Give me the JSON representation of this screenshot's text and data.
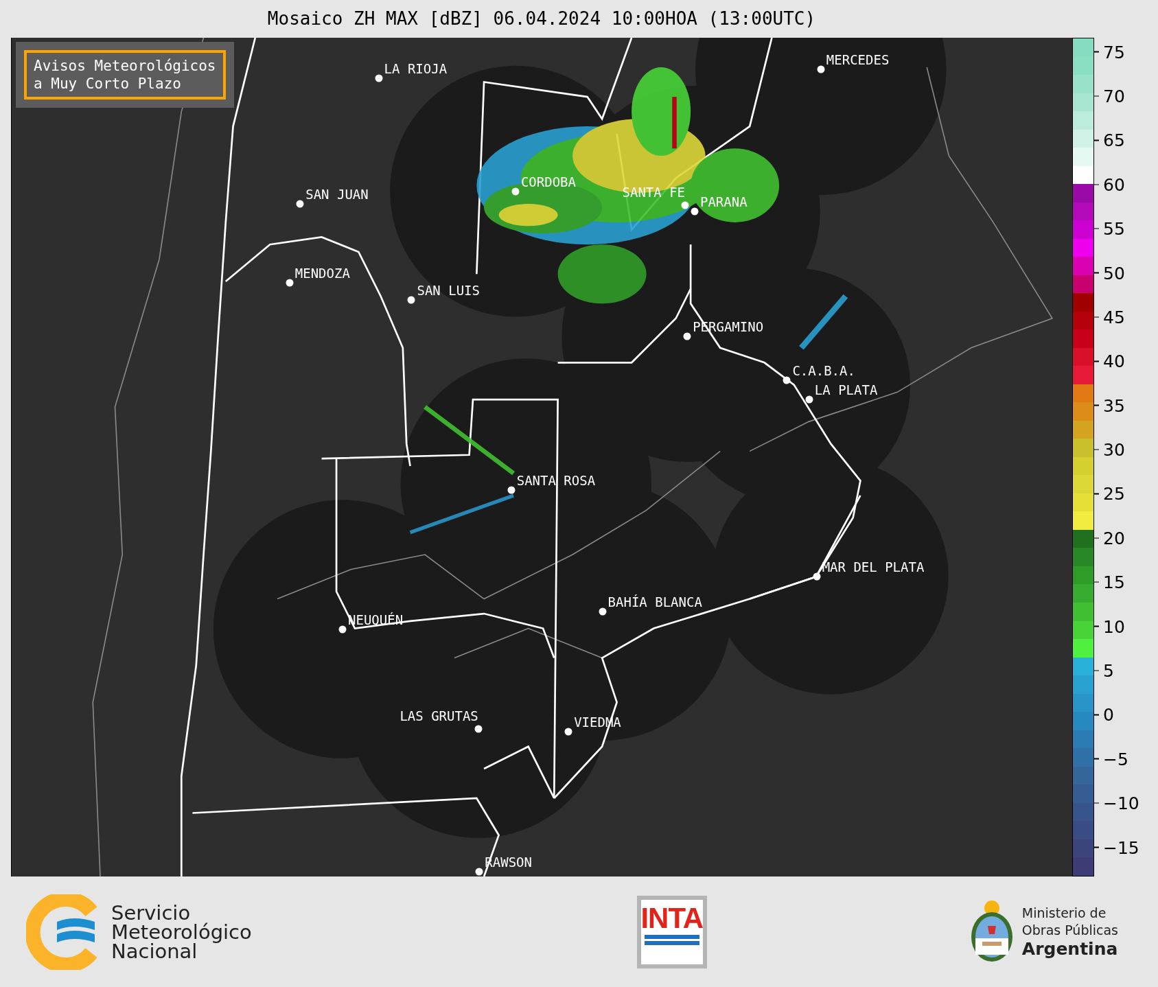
{
  "title": "Mosaico ZH MAX [dBZ] 06.04.2024 10:00HOA (13:00UTC)",
  "notice": {
    "lines": [
      "Avisos Meteorológicos",
      "a Muy Corto Plazo"
    ]
  },
  "cities": [
    {
      "name": "LA RIOJA"
    },
    {
      "name": "MERCEDES"
    },
    {
      "name": "CORDOBA"
    },
    {
      "name": "SAN JUAN"
    },
    {
      "name": "SANTA FE"
    },
    {
      "name": "PARANA"
    },
    {
      "name": "MENDOZA"
    },
    {
      "name": "SAN LUIS"
    },
    {
      "name": "PERGAMINO"
    },
    {
      "name": "C.A.B.A."
    },
    {
      "name": "LA PLATA"
    },
    {
      "name": "SANTA ROSA"
    },
    {
      "name": "MAR DEL PLATA"
    },
    {
      "name": "BAHÍA BLANCA"
    },
    {
      "name": "NEUQUÉN"
    },
    {
      "name": "LAS GRUTAS"
    },
    {
      "name": "VIEDMA"
    },
    {
      "name": "RAWSON"
    }
  ],
  "colorbar": {
    "ticks": [
      "75",
      "70",
      "65",
      "60",
      "55",
      "50",
      "45",
      "40",
      "35",
      "30",
      "25",
      "20",
      "15",
      "10",
      "5",
      "0",
      "−5",
      "−10",
      "−15"
    ]
  },
  "footer": {
    "smn": [
      "Servicio",
      "Meteorológico",
      "Nacional"
    ],
    "inta": "INTA",
    "ministry": [
      "Ministerio de",
      "Obras Públicas",
      "Argentina"
    ]
  }
}
